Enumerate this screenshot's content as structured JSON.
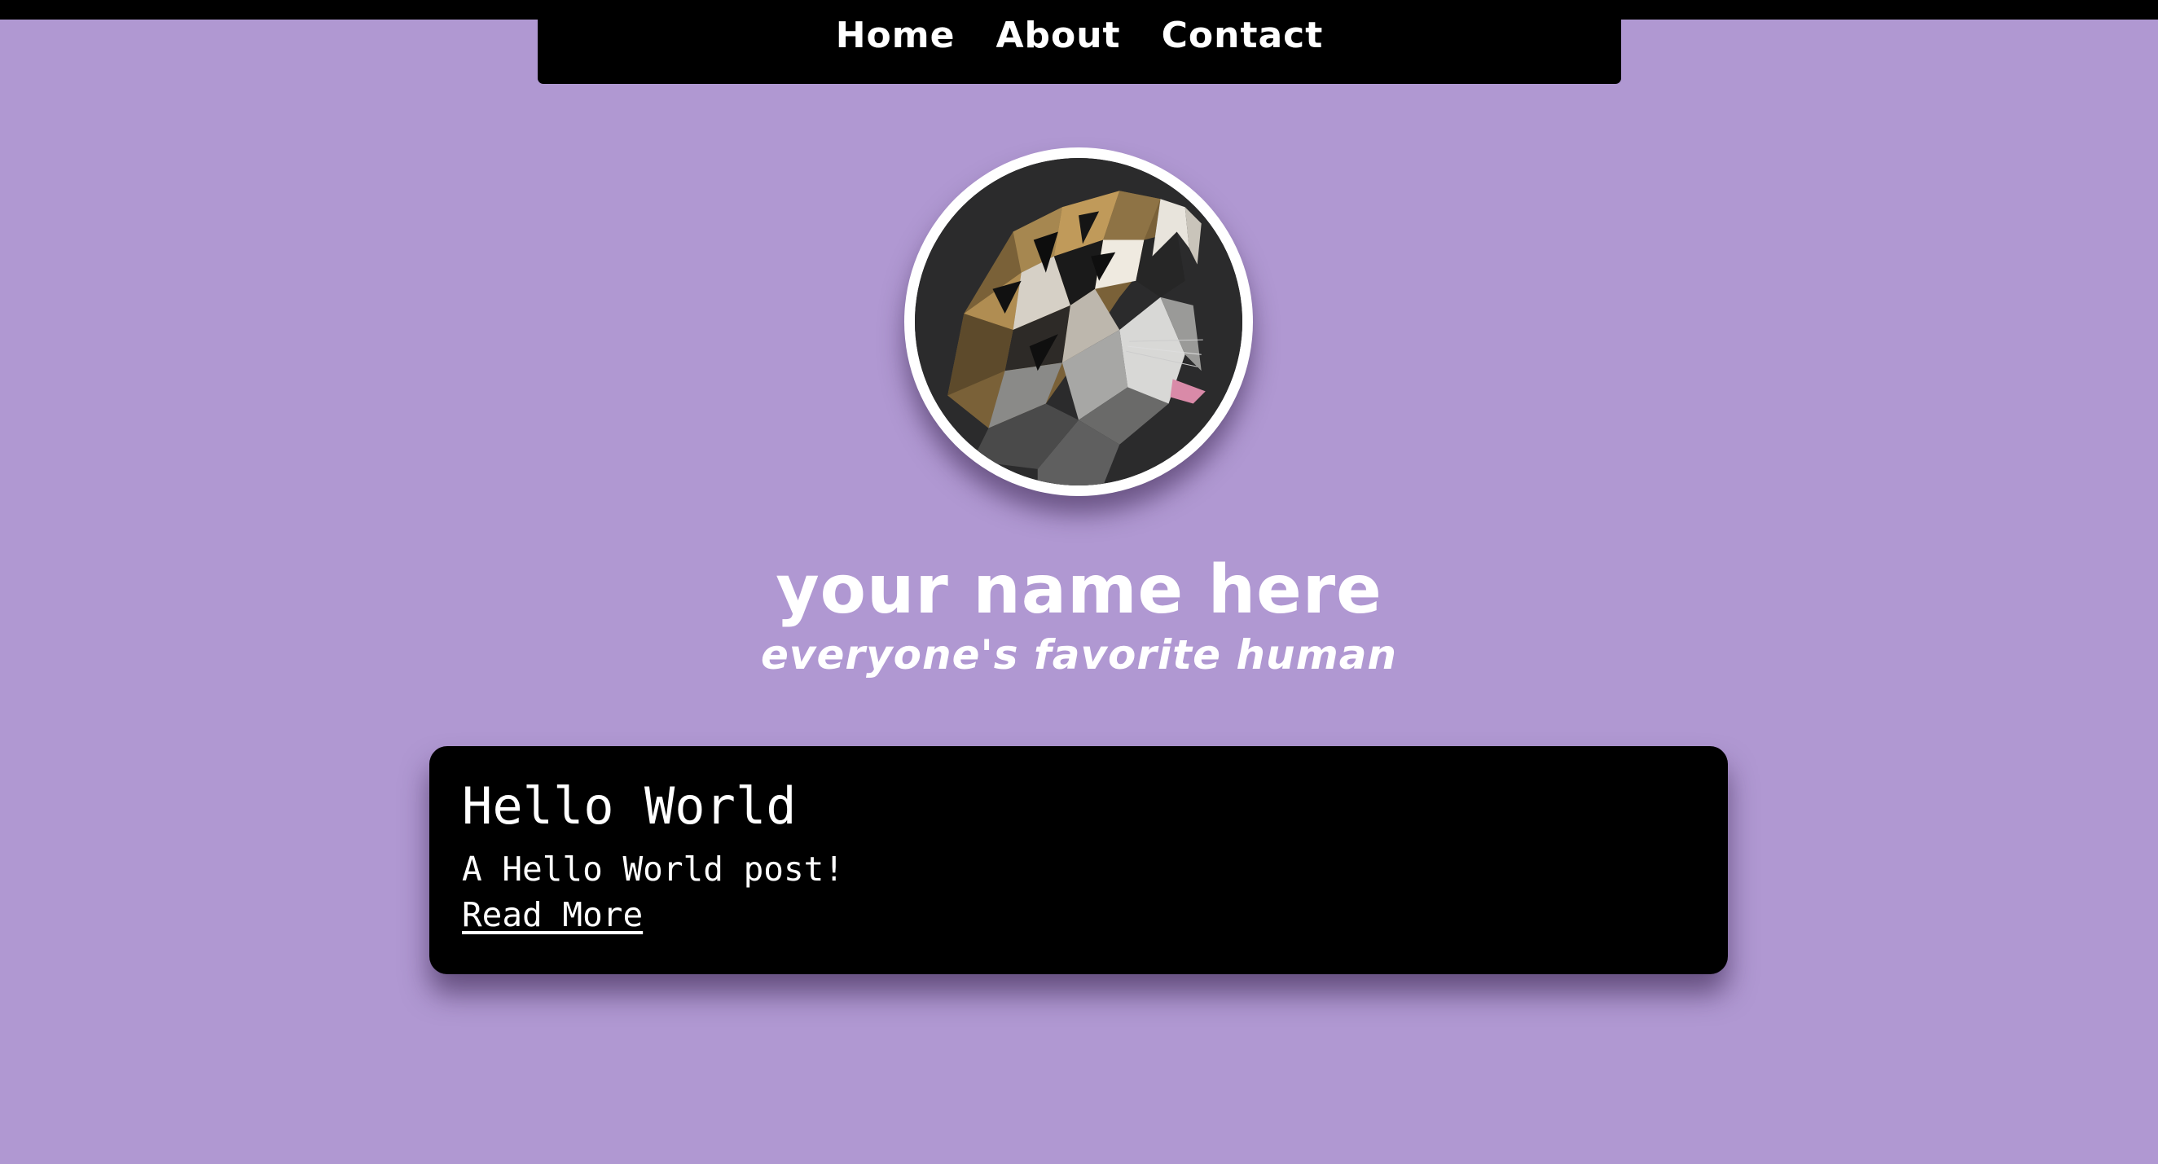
{
  "nav": {
    "links": [
      {
        "label": "Home"
      },
      {
        "label": "About"
      },
      {
        "label": "Contact"
      }
    ]
  },
  "profile": {
    "avatar_icon": "tiger-avatar-icon",
    "name": "your name here",
    "tagline": "everyone's favorite human"
  },
  "posts": [
    {
      "title": "Hello World",
      "excerpt": "A Hello World post!",
      "link_label": "Read More"
    }
  ],
  "colors": {
    "background": "#b098d2",
    "nav_background": "#000000",
    "card_background": "#000000",
    "text": "#ffffff"
  }
}
